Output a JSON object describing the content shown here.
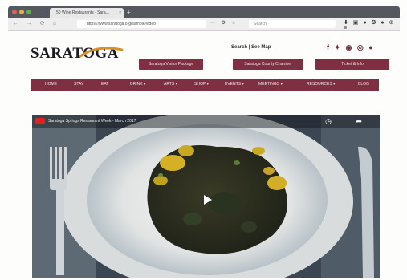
{
  "browser": {
    "tab_title": "50 Wine Restaurants - Sara...",
    "tab_close": "×",
    "new_tab": "+",
    "nav_buttons": "← → ⟳ ⌂",
    "url": "https://www.saratoga.org/sample/video",
    "addr_icons": "⋯ ✪ ☆",
    "search_placeholder": "Search",
    "ext_icons": "⬇ ▣ ● ✪ ● ⊕ ≡"
  },
  "site": {
    "logo": "SARATOGA",
    "find_link": "Search | See Map",
    "social_icons": "f ✦ ◉ ◎ ●",
    "buttons": [
      "Saratoga Visitor Package",
      "Saratoga County Chamber",
      "Ticket & Info"
    ],
    "nav": [
      "HOME",
      "STAY",
      "EAT",
      "DRINK ▾",
      "ARTS ▾",
      "SHOP ▾",
      "EVENTS ▾",
      "MEETINGS ▾",
      "RESOURCES ▾",
      "BLOG"
    ]
  },
  "video": {
    "title": "Saratoga Springs Restaurant Week - March 2017",
    "actions": "◷ ➦"
  },
  "colors": {
    "brand": "#7e2f41",
    "accent": "#d89028"
  }
}
